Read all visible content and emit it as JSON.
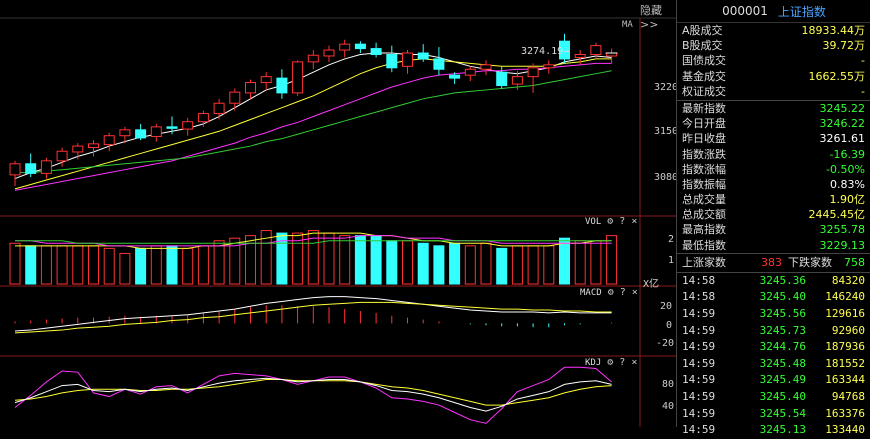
{
  "header": {
    "hide_label": "隐藏>>",
    "code": "000001",
    "name": "上证指数"
  },
  "kline": {
    "ma_label": "MA",
    "price_annotation": "3274.19→",
    "y_ticks": [
      "3220",
      "3150",
      "3080"
    ],
    "candles": [
      {
        "o": 3093,
        "h": 3112,
        "l": 3078,
        "c": 3108
      },
      {
        "o": 3108,
        "h": 3122,
        "l": 3090,
        "c": 3095
      },
      {
        "o": 3095,
        "h": 3116,
        "l": 3088,
        "c": 3112
      },
      {
        "o": 3112,
        "h": 3130,
        "l": 3104,
        "c": 3125
      },
      {
        "o": 3124,
        "h": 3136,
        "l": 3114,
        "c": 3132
      },
      {
        "o": 3130,
        "h": 3140,
        "l": 3118,
        "c": 3135
      },
      {
        "o": 3134,
        "h": 3150,
        "l": 3125,
        "c": 3146
      },
      {
        "o": 3146,
        "h": 3158,
        "l": 3136,
        "c": 3154
      },
      {
        "o": 3154,
        "h": 3162,
        "l": 3140,
        "c": 3143
      },
      {
        "o": 3145,
        "h": 3162,
        "l": 3138,
        "c": 3158
      },
      {
        "o": 3158,
        "h": 3172,
        "l": 3148,
        "c": 3156
      },
      {
        "o": 3155,
        "h": 3170,
        "l": 3146,
        "c": 3165
      },
      {
        "o": 3165,
        "h": 3180,
        "l": 3158,
        "c": 3176
      },
      {
        "o": 3176,
        "h": 3196,
        "l": 3168,
        "c": 3190
      },
      {
        "o": 3190,
        "h": 3210,
        "l": 3180,
        "c": 3205
      },
      {
        "o": 3204,
        "h": 3222,
        "l": 3196,
        "c": 3218
      },
      {
        "o": 3218,
        "h": 3232,
        "l": 3208,
        "c": 3226
      },
      {
        "o": 3224,
        "h": 3236,
        "l": 3196,
        "c": 3204
      },
      {
        "o": 3204,
        "h": 3248,
        "l": 3200,
        "c": 3246
      },
      {
        "o": 3246,
        "h": 3262,
        "l": 3236,
        "c": 3255
      },
      {
        "o": 3254,
        "h": 3268,
        "l": 3246,
        "c": 3262
      },
      {
        "o": 3262,
        "h": 3276,
        "l": 3252,
        "c": 3270
      },
      {
        "o": 3270,
        "h": 3274,
        "l": 3258,
        "c": 3264
      },
      {
        "o": 3264,
        "h": 3272,
        "l": 3252,
        "c": 3256
      },
      {
        "o": 3256,
        "h": 3268,
        "l": 3232,
        "c": 3238
      },
      {
        "o": 3240,
        "h": 3262,
        "l": 3230,
        "c": 3258
      },
      {
        "o": 3258,
        "h": 3270,
        "l": 3246,
        "c": 3250
      },
      {
        "o": 3250,
        "h": 3266,
        "l": 3228,
        "c": 3236
      },
      {
        "o": 3228,
        "h": 3232,
        "l": 3216,
        "c": 3224
      },
      {
        "o": 3228,
        "h": 3240,
        "l": 3220,
        "c": 3236
      },
      {
        "o": 3236,
        "h": 3248,
        "l": 3228,
        "c": 3242
      },
      {
        "o": 3232,
        "h": 3240,
        "l": 3210,
        "c": 3214
      },
      {
        "o": 3216,
        "h": 3234,
        "l": 3208,
        "c": 3226
      },
      {
        "o": 3226,
        "h": 3244,
        "l": 3204,
        "c": 3238
      },
      {
        "o": 3238,
        "h": 3248,
        "l": 3230,
        "c": 3242
      },
      {
        "o": 3274,
        "h": 3284,
        "l": 3244,
        "c": 3250
      },
      {
        "o": 3252,
        "h": 3262,
        "l": 3242,
        "c": 3256
      },
      {
        "o": 3256,
        "h": 3272,
        "l": 3250,
        "c": 3268
      },
      {
        "o": 3254,
        "h": 3264,
        "l": 3244,
        "c": 3258
      }
    ],
    "ma_lines": [
      {
        "color": "#ffffff",
        "values": [
          3088,
          3096,
          3102,
          3110,
          3118,
          3124,
          3132,
          3138,
          3144,
          3148,
          3152,
          3156,
          3162,
          3172,
          3184,
          3196,
          3208,
          3214,
          3222,
          3232,
          3242,
          3250,
          3256,
          3258,
          3258,
          3256,
          3256,
          3252,
          3246,
          3240,
          3236,
          3232,
          3230,
          3234,
          3238,
          3246,
          3250,
          3254,
          3252
        ]
      },
      {
        "color": "#ffff33",
        "values": [
          3074,
          3080,
          3086,
          3092,
          3098,
          3104,
          3110,
          3116,
          3122,
          3128,
          3134,
          3140,
          3146,
          3152,
          3160,
          3168,
          3176,
          3184,
          3192,
          3200,
          3210,
          3220,
          3230,
          3238,
          3244,
          3248,
          3250,
          3248,
          3246,
          3244,
          3242,
          3240,
          3240,
          3240,
          3240,
          3244,
          3246,
          3250,
          3250
        ]
      },
      {
        "color": "#ff33ff",
        "values": [
          3072,
          3076,
          3080,
          3084,
          3088,
          3092,
          3096,
          3100,
          3104,
          3108,
          3112,
          3118,
          3124,
          3130,
          3136,
          3144,
          3150,
          3158,
          3164,
          3172,
          3180,
          3188,
          3196,
          3204,
          3212,
          3218,
          3224,
          3228,
          3230,
          3232,
          3234,
          3234,
          3236,
          3236,
          3238,
          3240,
          3242,
          3244,
          3244
        ]
      },
      {
        "color": "#33cc33",
        "values": [
          3096,
          3096,
          3098,
          3100,
          3102,
          3104,
          3106,
          3108,
          3110,
          3112,
          3114,
          3116,
          3120,
          3124,
          3128,
          3132,
          3138,
          3142,
          3148,
          3154,
          3160,
          3166,
          3172,
          3178,
          3184,
          3190,
          3196,
          3200,
          3204,
          3206,
          3208,
          3210,
          3212,
          3214,
          3218,
          3222,
          3226,
          3230,
          3234
        ]
      }
    ]
  },
  "vol": {
    "label": "VOL",
    "y_ticks": [
      "2",
      "1"
    ],
    "unit": "X亿",
    "values": [
      1.6,
      1.5,
      1.5,
      1.5,
      1.5,
      1.5,
      1.4,
      1.2,
      1.4,
      1.5,
      1.5,
      1.4,
      1.5,
      1.7,
      1.8,
      1.9,
      2.1,
      2.0,
      2.0,
      2.1,
      2.0,
      1.9,
      1.9,
      1.9,
      1.7,
      1.7,
      1.6,
      1.5,
      1.6,
      1.5,
      1.6,
      1.4,
      1.5,
      1.5,
      1.5,
      1.8,
      1.7,
      1.7,
      1.9
    ],
    "ma_lines": [
      {
        "color": "#ffff33",
        "values": [
          1.5,
          1.5,
          1.5,
          1.5,
          1.5,
          1.5,
          1.5,
          1.5,
          1.4,
          1.4,
          1.4,
          1.4,
          1.5,
          1.5,
          1.6,
          1.7,
          1.8,
          1.9,
          1.9,
          2.0,
          2.0,
          2.0,
          2.0,
          1.9,
          1.9,
          1.8,
          1.7,
          1.7,
          1.6,
          1.6,
          1.6,
          1.5,
          1.5,
          1.5,
          1.5,
          1.6,
          1.6,
          1.7,
          1.7
        ]
      },
      {
        "color": "#ff33ff",
        "values": [
          1.7,
          1.7,
          1.6,
          1.6,
          1.6,
          1.6,
          1.5,
          1.5,
          1.5,
          1.5,
          1.5,
          1.5,
          1.5,
          1.5,
          1.5,
          1.6,
          1.6,
          1.7,
          1.7,
          1.8,
          1.8,
          1.8,
          1.9,
          1.9,
          1.9,
          1.8,
          1.8,
          1.8,
          1.7,
          1.7,
          1.7,
          1.6,
          1.6,
          1.6,
          1.6,
          1.6,
          1.6,
          1.6,
          1.6
        ]
      },
      {
        "color": "#33cc33",
        "values": [
          1.7,
          1.7,
          1.7,
          1.7,
          1.6,
          1.6,
          1.6,
          1.6,
          1.6,
          1.6,
          1.6,
          1.6,
          1.6,
          1.6,
          1.6,
          1.6,
          1.6,
          1.6,
          1.6,
          1.6,
          1.7,
          1.7,
          1.7,
          1.7,
          1.7,
          1.7,
          1.7,
          1.7,
          1.7,
          1.7,
          1.7,
          1.7,
          1.7,
          1.7,
          1.7,
          1.7,
          1.7,
          1.7,
          1.7
        ]
      }
    ]
  },
  "macd": {
    "label": "MACD",
    "y_ticks": [
      "20",
      "0",
      "-20"
    ],
    "bars": [
      2,
      3,
      4,
      5,
      6,
      6,
      7,
      8,
      7,
      8,
      8,
      9,
      11,
      13,
      15,
      17,
      19,
      19,
      18,
      18,
      17,
      15,
      13,
      11,
      8,
      6,
      4,
      2,
      0,
      -1,
      -2,
      -3,
      -3,
      -4,
      -4,
      -2,
      -1,
      0,
      1
    ],
    "dif": [
      -8,
      -7,
      -5,
      -3,
      -1,
      1,
      3,
      5,
      6,
      7,
      8,
      9,
      11,
      13,
      15,
      18,
      21,
      23,
      25,
      27,
      28,
      28,
      27,
      26,
      24,
      22,
      20,
      18,
      16,
      14,
      13,
      12,
      12,
      12,
      11,
      12,
      11,
      11,
      11
    ],
    "dea": [
      -10,
      -9,
      -8,
      -7,
      -5,
      -4,
      -3,
      -1,
      0,
      1,
      3,
      4,
      6,
      7,
      9,
      11,
      13,
      15,
      17,
      19,
      20,
      21,
      22,
      22,
      22,
      21,
      20,
      19,
      18,
      17,
      16,
      15,
      15,
      14,
      14,
      13,
      13,
      12,
      12
    ]
  },
  "kdj": {
    "label": "KDJ",
    "y_ticks": [
      "80",
      "40"
    ],
    "k": [
      40,
      48,
      58,
      68,
      70,
      60,
      58,
      62,
      58,
      62,
      64,
      60,
      66,
      72,
      76,
      78,
      80,
      78,
      74,
      76,
      78,
      78,
      74,
      68,
      60,
      58,
      54,
      48,
      40,
      32,
      26,
      34,
      46,
      52,
      58,
      70,
      74,
      76,
      70
    ],
    "d": [
      44,
      46,
      50,
      56,
      60,
      62,
      62,
      62,
      60,
      60,
      62,
      62,
      64,
      66,
      70,
      74,
      78,
      78,
      76,
      76,
      76,
      76,
      74,
      70,
      66,
      64,
      60,
      54,
      48,
      42,
      36,
      36,
      40,
      44,
      48,
      56,
      62,
      66,
      68
    ],
    "j": [
      32,
      52,
      74,
      92,
      90,
      56,
      50,
      62,
      54,
      66,
      68,
      56,
      70,
      84,
      88,
      86,
      84,
      78,
      70,
      76,
      82,
      82,
      74,
      64,
      48,
      46,
      42,
      36,
      24,
      12,
      6,
      30,
      58,
      68,
      78,
      98,
      98,
      96,
      74
    ]
  },
  "stats": [
    {
      "label": "A股成交",
      "value": "18933.44万",
      "color": "yellow"
    },
    {
      "label": "B股成交",
      "value": "39.72万",
      "color": "yellow"
    },
    {
      "label": "国债成交",
      "value": "-",
      "color": "yellow"
    },
    {
      "label": "基金成交",
      "value": "1662.55万",
      "color": "yellow"
    },
    {
      "label": "权证成交",
      "value": "-",
      "color": "yellow"
    },
    {
      "label": "最新指数",
      "value": "3245.22",
      "color": "green"
    },
    {
      "label": "今日开盘",
      "value": "3246.22",
      "color": "green"
    },
    {
      "label": "昨日收盘",
      "value": "3261.61",
      "color": "white"
    },
    {
      "label": "指数涨跌",
      "value": "-16.39",
      "color": "green"
    },
    {
      "label": "指数涨幅",
      "value": "-0.50%",
      "color": "green"
    },
    {
      "label": "指数振幅",
      "value": "0.83%",
      "color": "white"
    },
    {
      "label": "总成交量",
      "value": "1.90亿",
      "color": "yellow"
    },
    {
      "label": "总成交额",
      "value": "2445.45亿",
      "color": "yellow"
    },
    {
      "label": "最高指数",
      "value": "3255.78",
      "color": "green"
    },
    {
      "label": "最低指数",
      "value": "3229.13",
      "color": "green"
    }
  ],
  "updown": {
    "up_label": "上涨家数",
    "up_value": "383",
    "down_label": "下跌家数",
    "down_value": "758"
  },
  "ticks": [
    {
      "time": "14:58",
      "price": "3245.36",
      "vol": "84320"
    },
    {
      "time": "14:58",
      "price": "3245.40",
      "vol": "146240"
    },
    {
      "time": "14:59",
      "price": "3245.56",
      "vol": "129616"
    },
    {
      "time": "14:59",
      "price": "3245.73",
      "vol": "92960"
    },
    {
      "time": "14:59",
      "price": "3244.76",
      "vol": "187936"
    },
    {
      "time": "14:59",
      "price": "3245.48",
      "vol": "181552"
    },
    {
      "time": "14:59",
      "price": "3245.49",
      "vol": "163344"
    },
    {
      "time": "14:59",
      "price": "3245.40",
      "vol": "94768"
    },
    {
      "time": "14:59",
      "price": "3245.54",
      "vol": "163376"
    },
    {
      "time": "14:59",
      "price": "3245.13",
      "vol": "133440"
    }
  ]
}
